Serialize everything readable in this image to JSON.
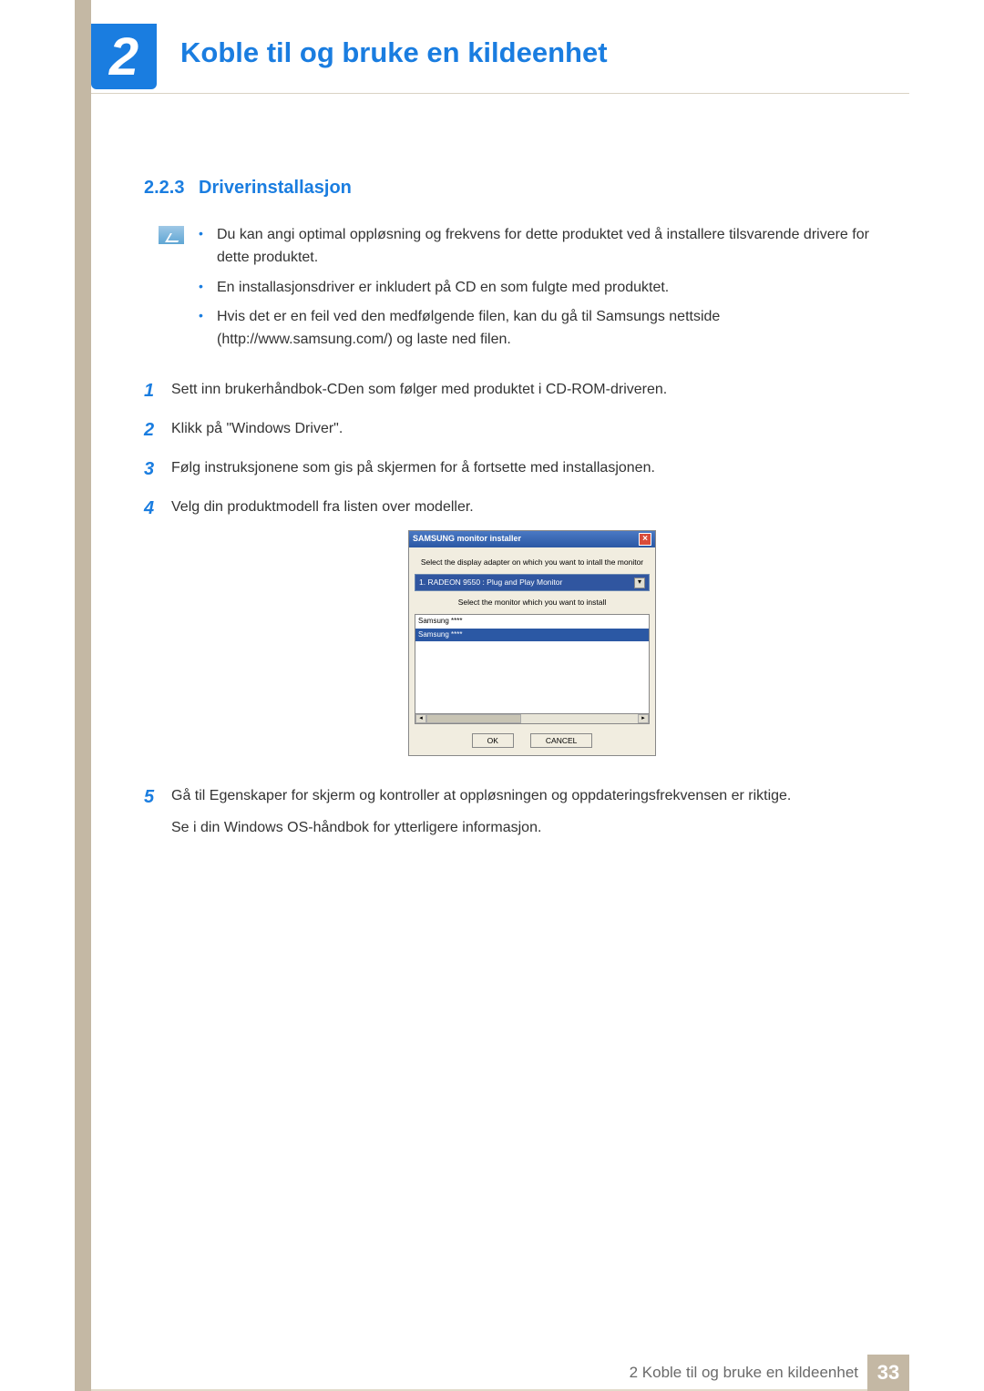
{
  "chapter": {
    "number": "2",
    "title": "Koble til og bruke en kildeenhet"
  },
  "section": {
    "number": "2.2.3",
    "title": "Driverinstallasjon"
  },
  "notes": [
    "Du kan angi optimal oppløsning og frekvens for dette produktet ved å installere tilsvarende drivere for dette produktet.",
    "En installasjonsdriver er inkludert på CD en som fulgte med produktet.",
    "Hvis det er en feil ved den medfølgende filen, kan du gå til Samsungs nettside (http://www.samsung.com/) og laste ned filen."
  ],
  "steps": [
    {
      "n": "1",
      "text": "Sett inn brukerhåndbok-CDen som følger med produktet i CD-ROM-driveren."
    },
    {
      "n": "2",
      "text": "Klikk på \"Windows Driver\"."
    },
    {
      "n": "3",
      "text": "Følg instruksjonene som gis på skjermen for å fortsette med installasjonen."
    },
    {
      "n": "4",
      "text": "Velg din produktmodell fra listen over modeller."
    },
    {
      "n": "5",
      "text": "Gå til Egenskaper for skjerm og kontroller at oppløsningen og oppdateringsfrekvensen er riktige.",
      "sub": "Se i din Windows OS-håndbok for ytterligere informasjon."
    }
  ],
  "installer": {
    "title": "SAMSUNG monitor installer",
    "label1": "Select the display adapter on which you want to intall the monitor",
    "adapter": "1. RADEON 9550 : Plug and Play Monitor",
    "label2": "Select the monitor which you want to install",
    "items": [
      "Samsung ****",
      "Samsung ****"
    ],
    "ok": "OK",
    "cancel": "CANCEL"
  },
  "footer": {
    "text": "2 Koble til og bruke en kildeenhet",
    "page": "33"
  }
}
